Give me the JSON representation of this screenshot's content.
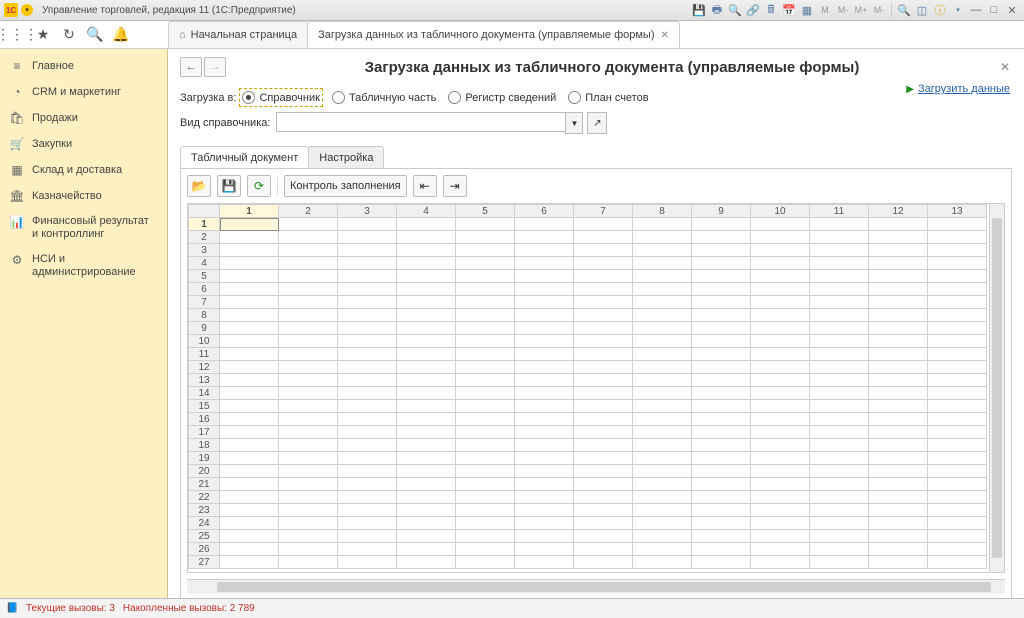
{
  "titlebar": {
    "logo_text": "1C",
    "title": "Управление торговлей, редакция 11  (1С:Предприятие)"
  },
  "top_icons": {
    "m": "M",
    "mminus": "M-",
    "mplus": "M+",
    "mend": "M-"
  },
  "main_tabs": {
    "home": "Начальная страница",
    "active": "Загрузка данных из табличного документа (управляемые формы)"
  },
  "sidebar": {
    "items": [
      {
        "icon": "≡",
        "label": "Главное"
      },
      {
        "icon": "◔",
        "label": "CRM и маркетинг"
      },
      {
        "icon": "🛍",
        "label": "Продажи"
      },
      {
        "icon": "🛒",
        "label": "Закупки"
      },
      {
        "icon": "▦",
        "label": "Склад и доставка"
      },
      {
        "icon": "🏛",
        "label": "Казначейство"
      },
      {
        "icon": "📊",
        "label": "Финансовый результат и контроллинг"
      },
      {
        "icon": "⚙",
        "label": "НСИ и администрирование"
      }
    ]
  },
  "page": {
    "title": "Загрузка данных из табличного документа (управляемые формы)",
    "link": "Загрузить данные",
    "load_into_label": "Загрузка в:",
    "radios": [
      "Справочник",
      "Табличную часть",
      "Регистр сведений",
      "План счетов"
    ],
    "selected_radio": 0,
    "spr_label": "Вид справочника:",
    "spr_value": ""
  },
  "content_tabs": [
    "Табличный документ",
    "Настройка"
  ],
  "toolbar": {
    "fill_check": "Контроль заполнения"
  },
  "sheet": {
    "cols": [
      "1",
      "2",
      "3",
      "4",
      "5",
      "6",
      "7",
      "8",
      "9",
      "10",
      "11",
      "12",
      "13"
    ],
    "rows": 27,
    "selected_row": 1,
    "selected_col": 1
  },
  "status": {
    "current": "Текущие вызовы: 3",
    "accum": "Накопленные вызовы: 2 789"
  }
}
